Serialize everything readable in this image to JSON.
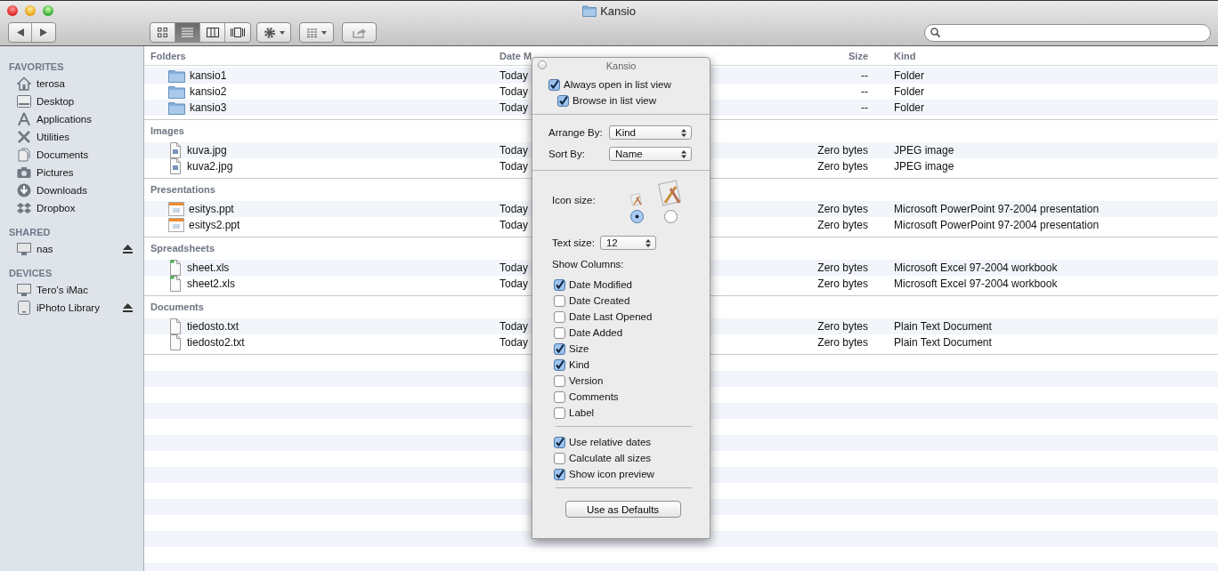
{
  "window": {
    "title": "Kansio"
  },
  "toolbar": {
    "view_modes": [
      {
        "kind": "icons",
        "selected": false
      },
      {
        "kind": "list",
        "selected": true
      },
      {
        "kind": "columns",
        "selected": false
      },
      {
        "kind": "coverflow",
        "selected": false
      }
    ]
  },
  "sidebar": {
    "sections": [
      {
        "title": "FAVORITES",
        "items": [
          {
            "label": "terosa",
            "kind": "home",
            "eject": false
          },
          {
            "label": "Desktop",
            "kind": "desktop",
            "eject": false
          },
          {
            "label": "Applications",
            "kind": "applications",
            "eject": false
          },
          {
            "label": "Utilities",
            "kind": "utilities",
            "eject": false
          },
          {
            "label": "Documents",
            "kind": "documents",
            "eject": false
          },
          {
            "label": "Pictures",
            "kind": "pictures",
            "eject": false
          },
          {
            "label": "Downloads",
            "kind": "downloads",
            "eject": false
          },
          {
            "label": "Dropbox",
            "kind": "dropbox",
            "eject": false
          }
        ]
      },
      {
        "title": "SHARED",
        "items": [
          {
            "label": "nas",
            "kind": "computer",
            "eject": true
          }
        ]
      },
      {
        "title": "DEVICES",
        "items": [
          {
            "label": "Tero’s iMac",
            "kind": "computer",
            "eject": false
          },
          {
            "label": "iPhoto Library",
            "kind": "disk",
            "eject": true
          }
        ]
      }
    ]
  },
  "table": {
    "columns": [
      {
        "label": "Date M"
      },
      {
        "label": "Size"
      },
      {
        "label": "Kind"
      }
    ],
    "groups": [
      {
        "name": "Folders",
        "rows": [
          {
            "kind": "folder",
            "name": "kansio1",
            "date": "Today",
            "size": "--",
            "type": "Folder"
          },
          {
            "kind": "folder",
            "name": "kansio2",
            "date": "Today",
            "size": "--",
            "type": "Folder"
          },
          {
            "kind": "folder",
            "name": "kansio3",
            "date": "Today",
            "size": "--",
            "type": "Folder"
          }
        ]
      },
      {
        "name": "Images",
        "rows": [
          {
            "kind": "image",
            "name": "kuva.jpg",
            "date": "Today",
            "size": "Zero bytes",
            "type": "JPEG image"
          },
          {
            "kind": "image",
            "name": "kuva2.jpg",
            "date": "Today",
            "size": "Zero bytes",
            "type": "JPEG image"
          }
        ]
      },
      {
        "name": "Presentations",
        "rows": [
          {
            "kind": "presentation",
            "name": "esitys.ppt",
            "date": "Today",
            "size": "Zero bytes",
            "type": "Microsoft PowerPoint 97-2004 presentation"
          },
          {
            "kind": "presentation",
            "name": "esitys2.ppt",
            "date": "Today",
            "size": "Zero bytes",
            "type": "Microsoft PowerPoint 97-2004 presentation"
          }
        ]
      },
      {
        "name": "Spreadsheets",
        "rows": [
          {
            "kind": "spreadsheet",
            "name": "sheet.xls",
            "date": "Today",
            "size": "Zero bytes",
            "type": "Microsoft Excel 97-2004 workbook"
          },
          {
            "kind": "spreadsheet",
            "name": "sheet2.xls",
            "date": "Today",
            "size": "Zero bytes",
            "type": "Microsoft Excel 97-2004 workbook"
          }
        ]
      },
      {
        "name": "Documents",
        "rows": [
          {
            "kind": "text",
            "name": "tiedosto.txt",
            "date": "Today",
            "size": "Zero bytes",
            "type": "Plain Text Document"
          },
          {
            "kind": "text",
            "name": "tiedosto2.txt",
            "date": "Today",
            "size": "Zero bytes",
            "type": "Plain Text Document"
          }
        ]
      }
    ]
  },
  "panel": {
    "title": "Kansio",
    "view_options": [
      {
        "label": "Always open in list view",
        "checked": true,
        "children": [
          {
            "label": "Browse in list view",
            "checked": true
          }
        ]
      }
    ],
    "arrange_by": {
      "label": "Arrange By:",
      "value": "Kind"
    },
    "sort_by": {
      "label": "Sort By:",
      "value": "Name"
    },
    "icon_size": {
      "label": "Icon size:",
      "options": [
        {
          "selected": true
        },
        {
          "selected": false
        }
      ]
    },
    "text_size": {
      "label": "Text size:",
      "value": "12"
    },
    "show_columns": {
      "label": "Show Columns:",
      "items": [
        {
          "label": "Date Modified",
          "checked": true
        },
        {
          "label": "Date Created",
          "checked": false
        },
        {
          "label": "Date Last Opened",
          "checked": false
        },
        {
          "label": "Date Added",
          "checked": false
        },
        {
          "label": "Size",
          "checked": true
        },
        {
          "label": "Kind",
          "checked": true
        },
        {
          "label": "Version",
          "checked": false
        },
        {
          "label": "Comments",
          "checked": false
        },
        {
          "label": "Label",
          "checked": false
        }
      ]
    },
    "options": [
      {
        "label": "Use relative dates",
        "checked": true
      },
      {
        "label": "Calculate all sizes",
        "checked": false
      },
      {
        "label": "Show icon preview",
        "checked": true
      }
    ],
    "button": "Use as Defaults"
  }
}
